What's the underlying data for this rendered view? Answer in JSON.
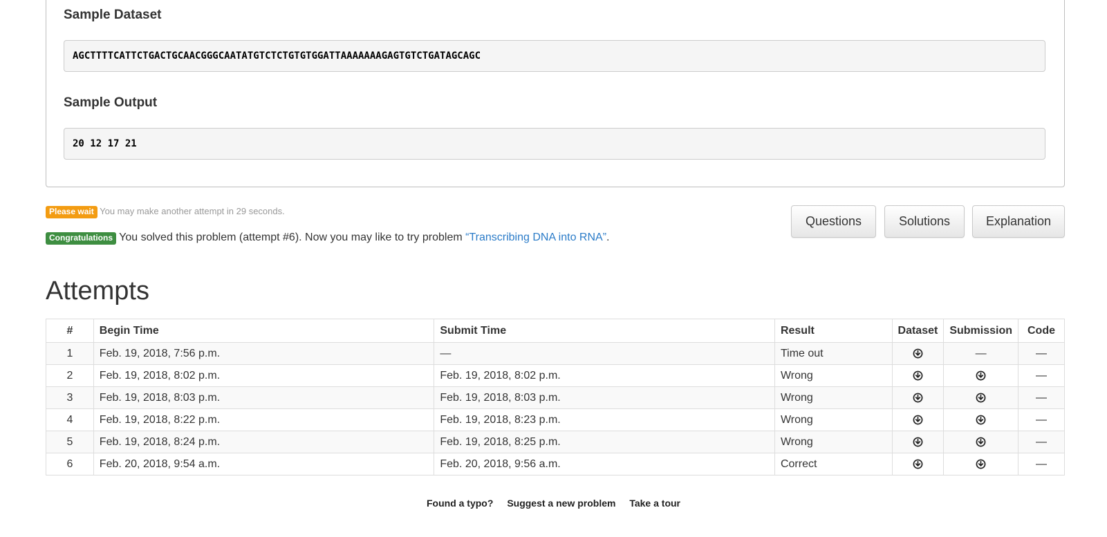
{
  "sample_dataset": {
    "title": "Sample Dataset",
    "value": "AGCTTTTCATTCTGACTGCAACGGGCAATATGTCTCTGTGTGGATTAAAAAAAGAGTGTCTGATAGCAGC"
  },
  "sample_output": {
    "title": "Sample Output",
    "value": "20 12 17 21"
  },
  "wait_message": {
    "badge": "Please wait",
    "text": "You may make another attempt in 29 seconds."
  },
  "congrats_message": {
    "badge": "Congratulations",
    "text": "You solved this problem (attempt #6). Now you may like to try problem ",
    "link_text": "“Transcribing DNA into RNA”",
    "suffix": "."
  },
  "buttons": {
    "questions": "Questions",
    "solutions": "Solutions",
    "explanation": "Explanation"
  },
  "attempts": {
    "title": "Attempts",
    "columns": [
      "#",
      "Begin Time",
      "Submit Time",
      "Result",
      "Dataset",
      "Submission",
      "Code"
    ],
    "rows": [
      {
        "num": "1",
        "begin": "Feb. 19, 2018, 7:56 p.m.",
        "submit": "—",
        "result": "Time out",
        "submission": "—",
        "code": "—"
      },
      {
        "num": "2",
        "begin": "Feb. 19, 2018, 8:02 p.m.",
        "submit": "Feb. 19, 2018, 8:02 p.m.",
        "result": "Wrong",
        "submission": "download-icon",
        "code": "—"
      },
      {
        "num": "3",
        "begin": "Feb. 19, 2018, 8:03 p.m.",
        "submit": "Feb. 19, 2018, 8:03 p.m.",
        "result": "Wrong",
        "submission": "download-icon",
        "code": "—"
      },
      {
        "num": "4",
        "begin": "Feb. 19, 2018, 8:22 p.m.",
        "submit": "Feb. 19, 2018, 8:23 p.m.",
        "result": "Wrong",
        "submission": "download-icon",
        "code": "—"
      },
      {
        "num": "5",
        "begin": "Feb. 19, 2018, 8:24 p.m.",
        "submit": "Feb. 19, 2018, 8:25 p.m.",
        "result": "Wrong",
        "submission": "download-icon",
        "code": "—"
      },
      {
        "num": "6",
        "begin": "Feb. 20, 2018, 9:54 a.m.",
        "submit": "Feb. 20, 2018, 9:56 a.m.",
        "result": "Correct",
        "submission": "download-icon",
        "code": "—"
      }
    ]
  },
  "footer": {
    "typo": "Found a typo?",
    "suggest": "Suggest a new problem",
    "tour": "Take a tour"
  },
  "colors": {
    "warning": "#f39c12",
    "success": "#3e8e41",
    "link": "#2a7bc8"
  }
}
